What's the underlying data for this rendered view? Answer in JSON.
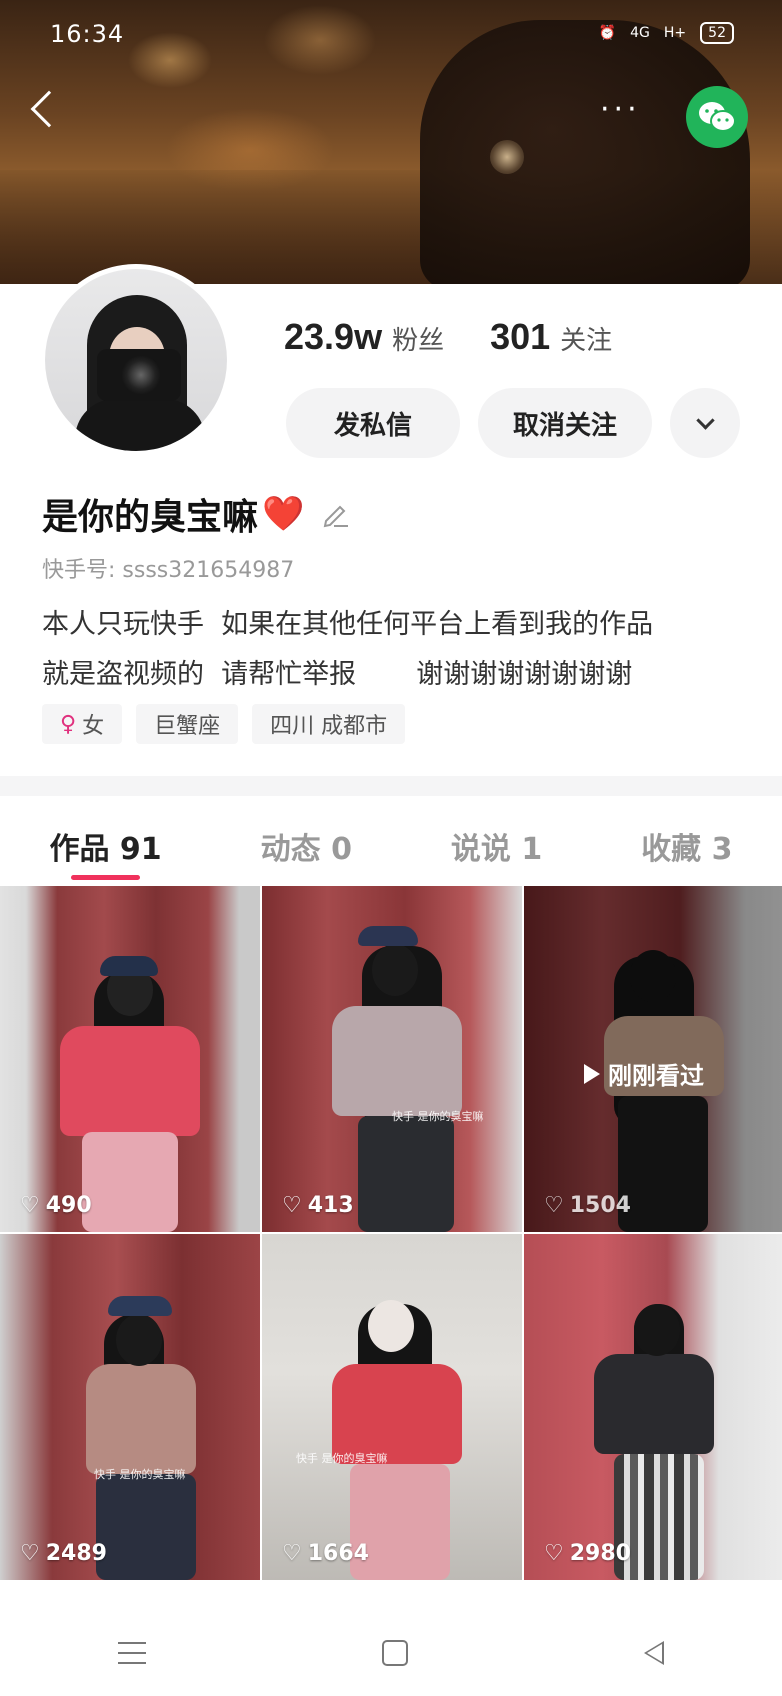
{
  "status_bar": {
    "time": "16:34",
    "network": "4G",
    "signal": "H+",
    "battery": "52"
  },
  "profile": {
    "fans_count": "23.9w",
    "fans_label": "粉丝",
    "following_count": "301",
    "following_label": "关注",
    "message_button": "发私信",
    "unfollow_button": "取消关注",
    "nickname": "是你的臭宝嘛",
    "heart_emoji": "❤️",
    "kuaishou_id": "快手号: ssss321654987",
    "bio": "本人只玩快手  如果在其他任何平台上看到我的作品\n就是盗视频的  请帮忙举报       谢谢谢谢谢谢谢谢",
    "tags": [
      "女",
      "巨蟹座",
      "四川 成都市"
    ]
  },
  "tabs": [
    {
      "label": "作品 91",
      "active": true
    },
    {
      "label": "动态 0",
      "active": false
    },
    {
      "label": "说说 1",
      "active": false
    },
    {
      "label": "收藏 3",
      "active": false
    }
  ],
  "videos": [
    {
      "likes": "490"
    },
    {
      "likes": "413"
    },
    {
      "likes": "1504",
      "overlay": "刚刚看过"
    },
    {
      "likes": "2489"
    },
    {
      "likes": "1664"
    },
    {
      "likes": "2980"
    }
  ],
  "colors": {
    "accent": "#f0315c",
    "wechat": "#21b45a",
    "heart": "#e0252f",
    "gender": "#e0317e"
  }
}
